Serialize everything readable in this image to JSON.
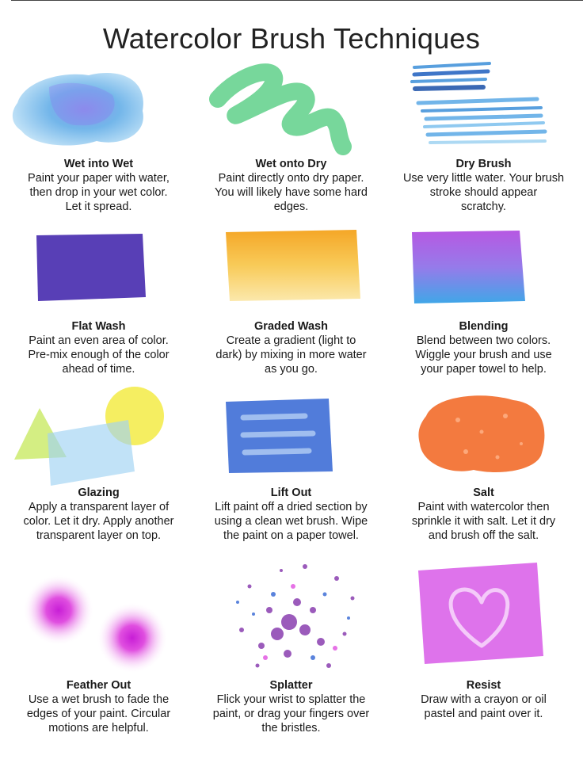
{
  "title": "Watercolor Brush Techniques",
  "techniques": [
    {
      "name": "Wet into Wet",
      "lines": [
        "Paint your paper with water,",
        "then drop in your wet color.",
        "Let it spread."
      ]
    },
    {
      "name": "Wet onto Dry",
      "lines": [
        "Paint directly onto dry paper.",
        "You will likely have some hard",
        "edges."
      ]
    },
    {
      "name": "Dry Brush",
      "lines": [
        "Use very little water. Your brush",
        "stroke should appear",
        "scratchy."
      ]
    },
    {
      "name": "Flat Wash",
      "lines": [
        "Paint an even area of color.",
        "Pre-mix enough of the color",
        "ahead of time."
      ]
    },
    {
      "name": "Graded Wash",
      "lines": [
        "Create a gradient (light to",
        "dark) by mixing in more water",
        "as you go."
      ]
    },
    {
      "name": "Blending",
      "lines": [
        "Blend between two colors.",
        "Wiggle your brush and use",
        "your paper towel to help."
      ]
    },
    {
      "name": "Glazing",
      "lines": [
        "Apply a transparent layer of",
        "color. Let it dry. Apply another",
        "transparent layer on top."
      ]
    },
    {
      "name": "Lift Out",
      "lines": [
        "Lift paint off a dried section by",
        "using a clean wet brush. Wipe",
        "the paint on a paper towel."
      ]
    },
    {
      "name": "Salt",
      "lines": [
        "Paint with watercolor then",
        "sprinkle it with salt. Let it dry",
        "and brush off the salt."
      ]
    },
    {
      "name": "Feather Out",
      "lines": [
        "Use a wet brush to fade the",
        "edges of your paint. Circular",
        "motions are helpful."
      ]
    },
    {
      "name": "Splatter",
      "lines": [
        "Flick your wrist to splatter the",
        "paint, or drag your fingers over",
        "the bristles."
      ]
    },
    {
      "name": "Resist",
      "lines": [
        "Draw with a crayon or oil",
        "pastel and paint over it."
      ]
    }
  ],
  "colors": {
    "wet_into_wet": "#5aa9e6",
    "wet_onto_dry": "#5fd08a",
    "dry_brush": "#3b8fd9",
    "flat_wash": "#4a2fb0",
    "graded_wash": "#f4a21c",
    "blend_top": "#b04ae0",
    "blend_bottom": "#2f9fe6",
    "glaze_yellow": "#f3ea3a",
    "glaze_green": "#c6e85a",
    "glaze_blue": "#9fd3f2",
    "lift_out": "#3e6ed6",
    "salt": "#f26b2a",
    "feather": "#e04fe0",
    "splatter": "#8a3fb0",
    "resist": "#d85ae8"
  }
}
